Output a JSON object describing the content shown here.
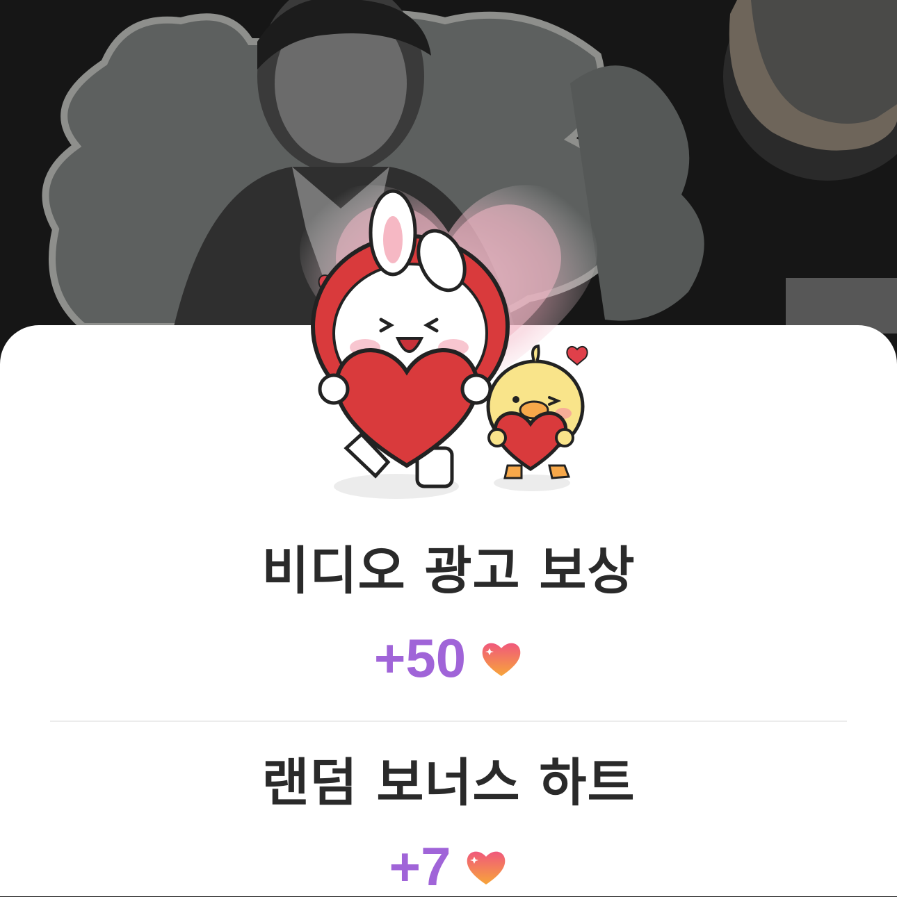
{
  "rewards": [
    {
      "title": "비디오 광고 보상",
      "amount": "+50",
      "icon": "heart-icon"
    },
    {
      "title": "랜덤 보너스 하트",
      "amount": "+7",
      "icon": "heart-icon"
    }
  ],
  "colors": {
    "accent": "#a064d8",
    "title": "#2a2a2a",
    "heart_top": "#f05a7a",
    "heart_bottom": "#f7a03a"
  }
}
